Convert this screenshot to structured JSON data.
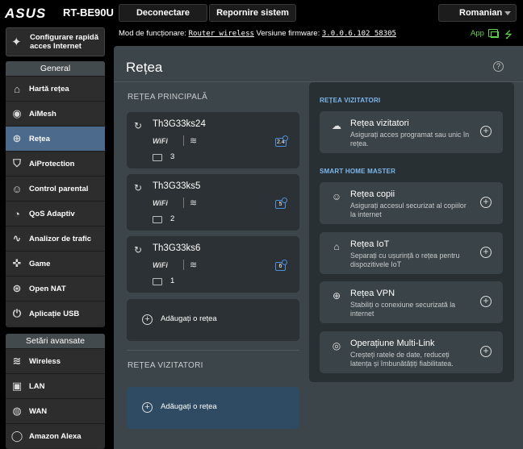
{
  "header": {
    "brand": "ASUS",
    "model": "RT-BE90U",
    "disconnect_label": "Deconectare",
    "reboot_label": "Repornire sistem",
    "language": "Romanian"
  },
  "status": {
    "mode_label": "Mod de funcționare:",
    "mode_value": "Router wireless",
    "firmware_label": "Versiune firmware:",
    "firmware_value": "3.0.0.6.102_58305",
    "app_label": "App"
  },
  "sidebar": {
    "quick_setup": "Configurare rapidă acces Internet",
    "general_header": "General",
    "general_items": [
      {
        "label": "Hartă rețea",
        "icon": "network-map-icon"
      },
      {
        "label": "AiMesh",
        "icon": "aimesh-icon"
      },
      {
        "label": "Rețea",
        "icon": "network-icon",
        "active": true
      },
      {
        "label": "AiProtection",
        "icon": "shield-icon"
      },
      {
        "label": "Control parental",
        "icon": "parental-icon"
      },
      {
        "label": "QoS Adaptiv",
        "icon": "qos-gauge-icon"
      },
      {
        "label": "Analizor de trafic",
        "icon": "traffic-chart-icon"
      },
      {
        "label": "Game",
        "icon": "gamepad-icon"
      },
      {
        "label": "Open NAT",
        "icon": "open-nat-icon"
      },
      {
        "label": "Aplicație USB",
        "icon": "usb-icon"
      }
    ],
    "advanced_header": "Setări avansate",
    "advanced_items": [
      {
        "label": "Wireless",
        "icon": "wireless-icon"
      },
      {
        "label": "LAN",
        "icon": "lan-icon"
      },
      {
        "label": "WAN",
        "icon": "wan-icon"
      },
      {
        "label": "Amazon Alexa",
        "icon": "alexa-icon"
      }
    ]
  },
  "main": {
    "title": "Rețea",
    "primary_section": "REȚEA PRINCIPALĂ",
    "networks": [
      {
        "name": "Th3G33ks24",
        "wifi": "WiFi",
        "band": "2.4",
        "devices": "3"
      },
      {
        "name": "Th3G33ks5",
        "wifi": "WiFi",
        "band": "5",
        "devices": "2"
      },
      {
        "name": "Th3G33ks6",
        "wifi": "WiFi",
        "band": "6",
        "devices": "1"
      }
    ],
    "add_network": "Adăugați o rețea",
    "guest_section": "REȚEA VIZITATORI",
    "add_guest_network": "Adăugați o rețea"
  },
  "right_panel": {
    "guest_header": "REȚEA VIZITATORI",
    "guest_cards": [
      {
        "title": "Rețea vizitatori",
        "desc": "Asigurați acces programat sau unic în rețea.",
        "icon": "guest-network-icon"
      }
    ],
    "smart_header": "SMART HOME MASTER",
    "smart_cards": [
      {
        "title": "Rețea copii",
        "desc": "Asigurați accesul securizat al copiilor la internet",
        "icon": "kids-network-icon"
      },
      {
        "title": "Rețea IoT",
        "desc": "Separați cu ușurință o rețea pentru dispozitivele IoT",
        "icon": "iot-home-icon"
      },
      {
        "title": "Rețea VPN",
        "desc": "Stabiliți o conexiune securizată la internet",
        "icon": "vpn-globe-icon"
      },
      {
        "title": "Operațiune Multi-Link",
        "desc": "Creșteți ratele de date, reduceți latența și îmbunătățiți fiabilitatea.",
        "icon": "multi-link-icon"
      }
    ]
  }
}
